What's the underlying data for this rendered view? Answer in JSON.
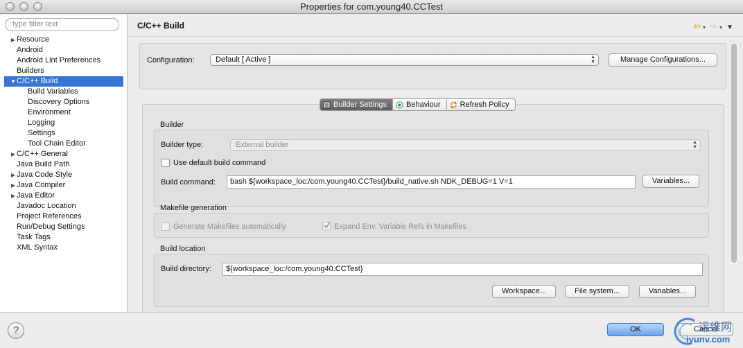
{
  "window": {
    "title": "Properties for com.young40.CCTest"
  },
  "sidebar": {
    "filter_placeholder": "type filter text",
    "items": [
      {
        "label": "Resource",
        "expandable": true,
        "expanded": false,
        "level": 0
      },
      {
        "label": "Android",
        "expandable": false,
        "level": 0
      },
      {
        "label": "Android Lint Preferences",
        "expandable": false,
        "level": 0
      },
      {
        "label": "Builders",
        "expandable": false,
        "level": 0
      },
      {
        "label": "C/C++ Build",
        "expandable": true,
        "expanded": true,
        "level": 0,
        "selected": true
      },
      {
        "label": "Build Variables",
        "expandable": false,
        "level": 1
      },
      {
        "label": "Discovery Options",
        "expandable": false,
        "level": 1
      },
      {
        "label": "Environment",
        "expandable": false,
        "level": 1
      },
      {
        "label": "Logging",
        "expandable": false,
        "level": 1
      },
      {
        "label": "Settings",
        "expandable": false,
        "level": 1
      },
      {
        "label": "Tool Chain Editor",
        "expandable": false,
        "level": 1
      },
      {
        "label": "C/C++ General",
        "expandable": true,
        "expanded": false,
        "level": 0
      },
      {
        "label": "Java Build Path",
        "expandable": false,
        "level": 0
      },
      {
        "label": "Java Code Style",
        "expandable": true,
        "expanded": false,
        "level": 0
      },
      {
        "label": "Java Compiler",
        "expandable": true,
        "expanded": false,
        "level": 0
      },
      {
        "label": "Java Editor",
        "expandable": true,
        "expanded": false,
        "level": 0
      },
      {
        "label": "Javadoc Location",
        "expandable": false,
        "level": 0
      },
      {
        "label": "Project References",
        "expandable": false,
        "level": 0
      },
      {
        "label": "Run/Debug Settings",
        "expandable": false,
        "level": 0
      },
      {
        "label": "Task Tags",
        "expandable": false,
        "level": 0
      },
      {
        "label": "XML Syntax",
        "expandable": false,
        "level": 0
      }
    ]
  },
  "main": {
    "title": "C/C++ Build",
    "configuration": {
      "label": "Configuration:",
      "value": "Default  [ Active ]",
      "manage_button": "Manage Configurations..."
    },
    "tabs": [
      {
        "label": "Builder Settings",
        "icon": "builder-settings-icon",
        "active": true
      },
      {
        "label": "Behaviour",
        "icon": "behaviour-icon",
        "active": false
      },
      {
        "label": "Refresh Policy",
        "icon": "refresh-policy-icon",
        "active": false
      }
    ],
    "builder": {
      "group_label": "Builder",
      "type_label": "Builder type:",
      "type_value": "External builder",
      "use_default_label": "Use default build command",
      "use_default_checked": false,
      "command_label": "Build command:",
      "command_value": "bash ${workspace_loc:/com.young40.CCTest}/build_native.sh NDK_DEBUG=1 V=1",
      "variables_button": "Variables..."
    },
    "makefile": {
      "group_label": "Makefile generation",
      "generate_label": "Generate Makefiles automatically",
      "generate_checked": false,
      "expand_label": "Expand Env. Variable Refs in Makefiles",
      "expand_checked": true
    },
    "location": {
      "group_label": "Build location",
      "directory_label": "Build directory:",
      "directory_value": "${workspace_loc:/com.young40.CCTest}",
      "workspace_button": "Workspace...",
      "filesystem_button": "File system...",
      "variables_button": "Variables..."
    }
  },
  "footer": {
    "help_symbol": "?",
    "ok_label": "OK",
    "cancel_label": "Cancel"
  },
  "watermark": {
    "chinese": "运维网",
    "url": "iyunv.com"
  },
  "colors": {
    "selection": "#3875d7",
    "ok_button": "#6aa3ec"
  }
}
